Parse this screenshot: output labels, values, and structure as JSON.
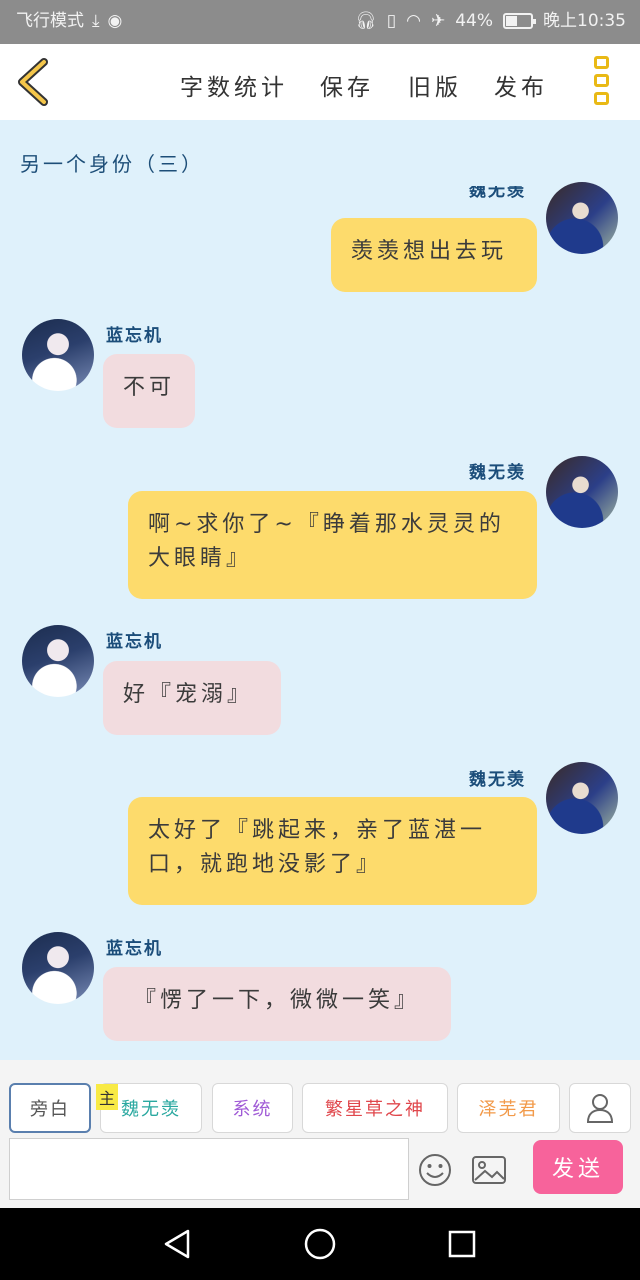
{
  "status_bar": {
    "airplane_label": "飞行模式",
    "battery_percent": "44%",
    "battery_level": 0.44,
    "time": "晚上10:35"
  },
  "toolbar": {
    "word_count": "字数统计",
    "save": "保存",
    "old_version": "旧版",
    "publish": "发布"
  },
  "chat": {
    "title": "另一个身份（三）",
    "messages": [
      {
        "sender": "魏无羡",
        "side": "right",
        "text": "羡羡想出去玩"
      },
      {
        "sender": "蓝忘机",
        "side": "left",
        "text": "不可"
      },
      {
        "sender": "魏无羡",
        "side": "right",
        "text": "啊~求你了~『睁着那水灵灵的大眼睛』"
      },
      {
        "sender": "蓝忘机",
        "side": "left",
        "text": "好『宠溺』"
      },
      {
        "sender": "魏无羡",
        "side": "right",
        "text": "太好了『跳起来，亲了蓝湛一口，就跑地没影了』"
      },
      {
        "sender": "蓝忘机",
        "side": "left",
        "text": "『愣了一下，微微一笑』"
      }
    ]
  },
  "roles": {
    "main_badge": "主",
    "items": [
      {
        "label": "旁白",
        "color": "#555555"
      },
      {
        "label": "魏无羡",
        "color": "#2aa8a0"
      },
      {
        "label": "系统",
        "color": "#a05bd6"
      },
      {
        "label": "繁星草之神",
        "color": "#e0474c"
      },
      {
        "label": "泽芜君",
        "color": "#f29a4a"
      }
    ]
  },
  "input": {
    "placeholder": "",
    "send": "发送"
  },
  "icons": {
    "back": "chevron-left-icon",
    "menu": "more-vertical-icon",
    "add_role": "user-icon",
    "emoji": "emoji-icon",
    "image": "image-icon",
    "nav_back": "triangle-back-icon",
    "nav_home": "circle-home-icon",
    "nav_recent": "square-recent-icon"
  },
  "colors": {
    "accent_yellow": "#fddb6c",
    "bubble_pink": "#f2dcdf",
    "send_pink": "#f7639b",
    "chat_bg": "#dff1fb",
    "menu_yellow": "#e9b915"
  }
}
